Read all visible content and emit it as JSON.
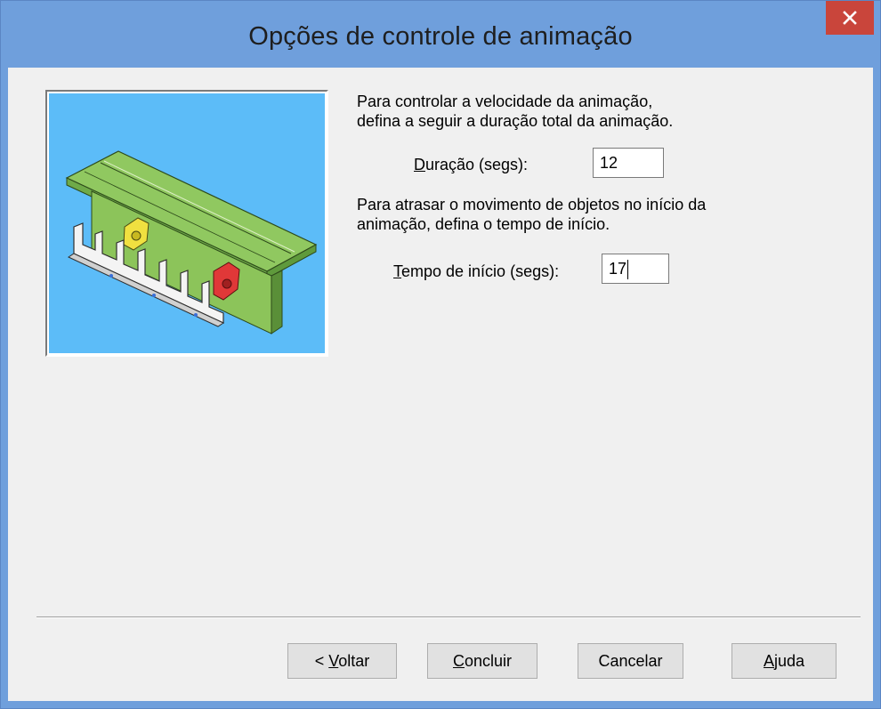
{
  "window": {
    "title": "Opções de controle de animação",
    "close_icon": "close-icon"
  },
  "illustration": {
    "icon": "animation-preview-image"
  },
  "speed": {
    "description_line1": "Para controlar a velocidade da animação,",
    "description_line2": "defina a seguir a duração total da animação.",
    "duration_label_accel": "D",
    "duration_label_rest": "uração (segs):",
    "duration_value": "12"
  },
  "delay": {
    "description_line1": "Para atrasar o movimento de objetos no início da",
    "description_line2": "animação, defina o tempo de início.",
    "start_label_accel": "T",
    "start_label_rest": "empo de início (segs):",
    "start_value": "17"
  },
  "buttons": {
    "back_prefix": "< ",
    "back_accel": "V",
    "back_rest": "oltar",
    "finish_accel": "C",
    "finish_rest": "oncluir",
    "cancel": "Cancelar",
    "help_accel": "A",
    "help_rest": "juda"
  },
  "colors": {
    "titlebar": "#6f9fdc",
    "close_button": "#c9453b",
    "preview_background": "#5cbcf8",
    "dialog_background": "#f0f0f0"
  }
}
